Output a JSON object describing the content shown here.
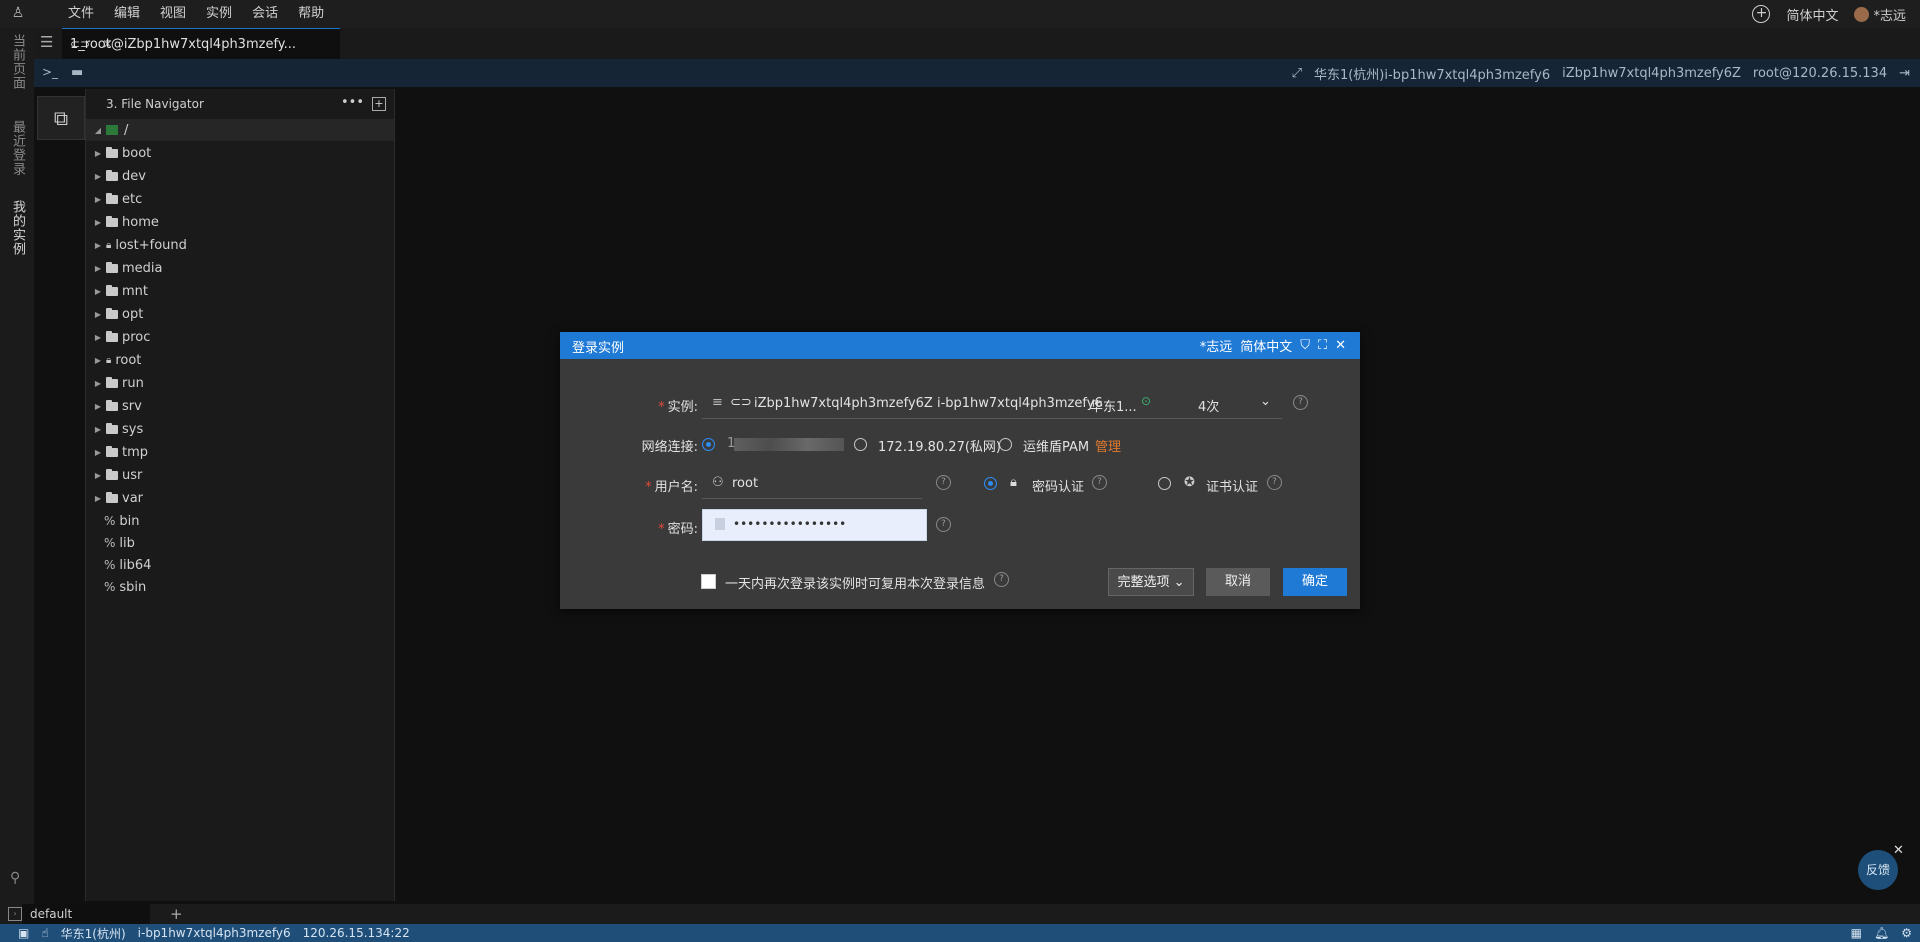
{
  "menubar": {
    "logo": "♙",
    "items": [
      "文件",
      "编辑",
      "视图",
      "实例",
      "会话",
      "帮助"
    ],
    "lang": "简体中文",
    "user": "*志远"
  },
  "vstrip": {
    "tabs": [
      "当前页面",
      "最近登录",
      "我的实例"
    ]
  },
  "tab": {
    "label": "1_root@iZbp1hw7xtql4ph3mzefy...",
    "close": "×"
  },
  "toolbar": {
    "terminal": ">_",
    "region": "华东1(杭州)i-bp1hw7xtql4ph3mzefy6",
    "hostname": "iZbp1hw7xtql4ph3mzefy6Z",
    "login": "root@120.26.15.134"
  },
  "filenav": {
    "title": "3. File Navigator",
    "root": "/",
    "dirs": [
      "boot",
      "dev",
      "etc",
      "home",
      "lost+found",
      "media",
      "mnt",
      "opt",
      "proc",
      "root",
      "run",
      "srv",
      "sys",
      "tmp",
      "usr",
      "var"
    ],
    "locked": [
      "lost+found",
      "root"
    ],
    "links": [
      "bin",
      "lib",
      "lib64",
      "sbin"
    ]
  },
  "dialog": {
    "title": "登录实例",
    "user": "*志远",
    "lang": "简体中文",
    "instance_label": "实例:",
    "instance_value": "iZbp1hw7xtql4ph3mzefy6Z i-bp1hw7xtql4ph3mzefy6",
    "region_short": "华东1...",
    "count": "4次",
    "network_label": "网络连接:",
    "public_ip": "1",
    "private_ip": "172.19.80.27(私网)",
    "pam": "运维盾PAM",
    "manage": "管理",
    "username_label": "用户名:",
    "username": "root",
    "auth_password": "密码认证",
    "auth_cert": "证书认证",
    "password_label": "密码:",
    "password_mask": "••••••••••••••••",
    "remember": "一天内再次登录该实例时可复用本次登录信息",
    "more": "完整选项",
    "cancel": "取消",
    "ok": "确定",
    "selected_network": "public",
    "selected_auth": "password"
  },
  "bottom": {
    "term_tab": "default",
    "region": "华东1(杭州)",
    "instance": "i-bp1hw7xtql4ph3mzefy6",
    "address": "120.26.15.134:22"
  },
  "feedback": "反馈"
}
